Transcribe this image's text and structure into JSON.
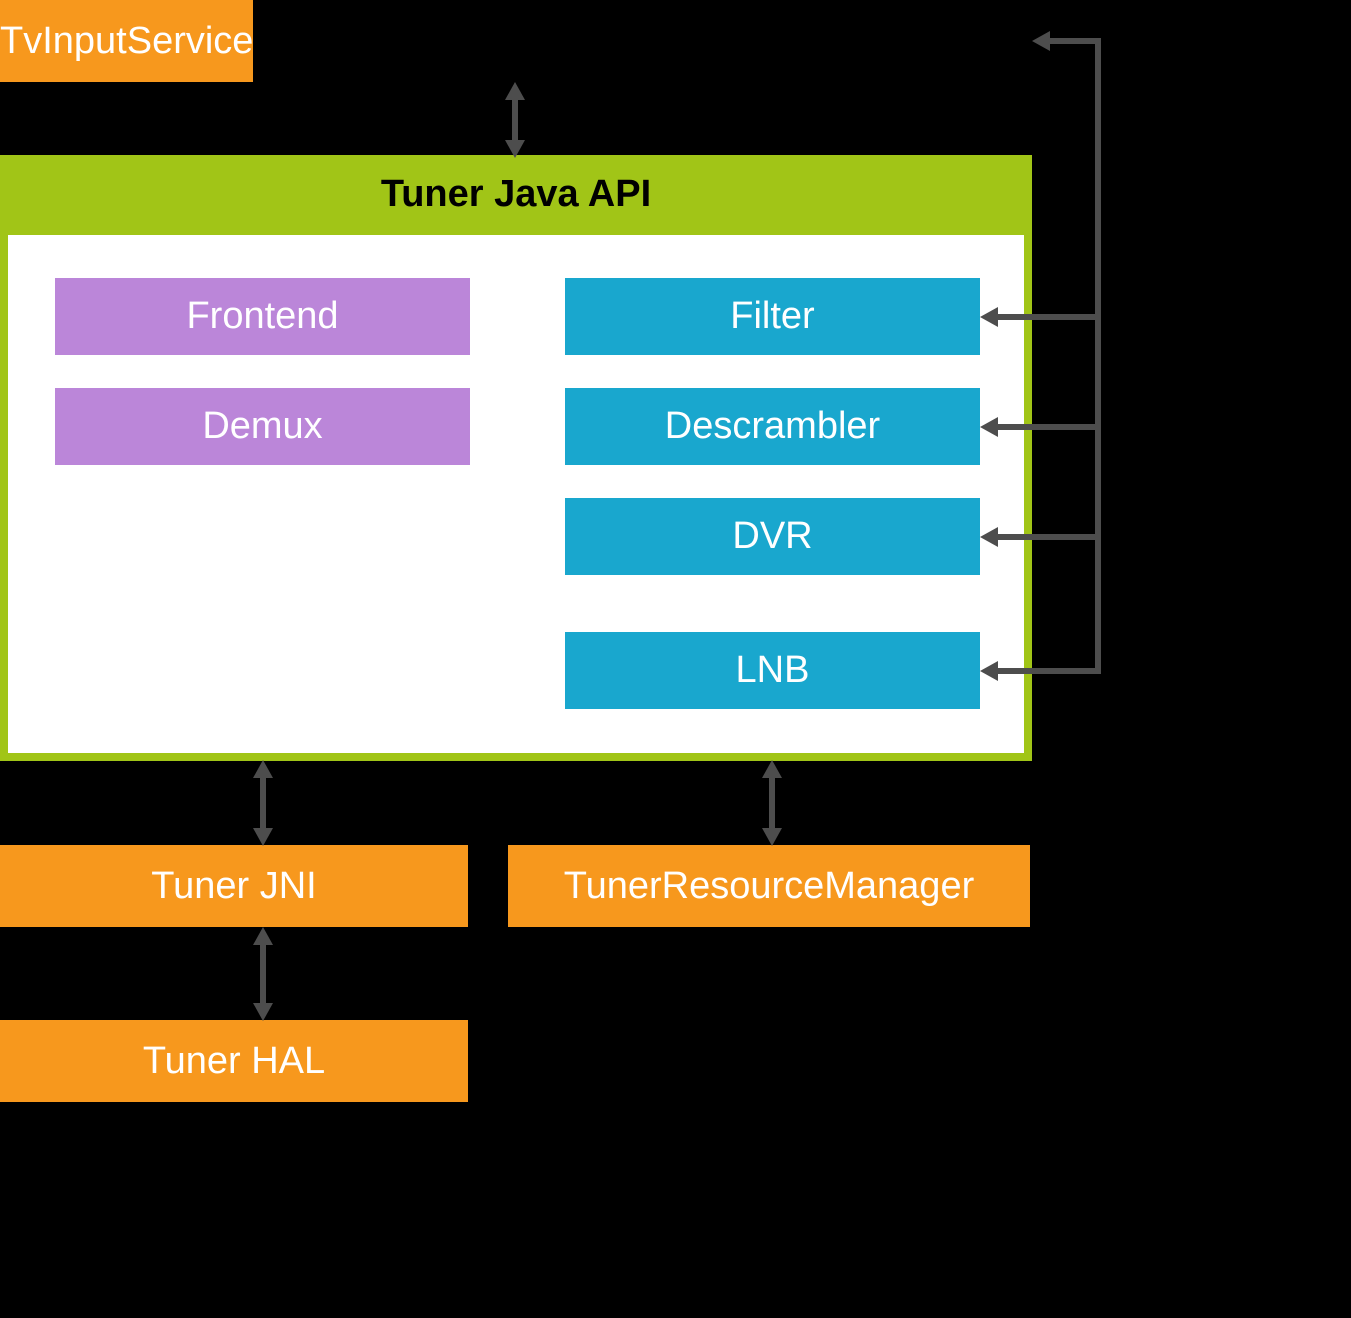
{
  "top": {
    "label": "TvInputService"
  },
  "middle": {
    "title": "Tuner Java API",
    "left": {
      "frontend": "Frontend",
      "demux": "Demux"
    },
    "right": {
      "filter": "Filter",
      "descrambler": "Descrambler",
      "dvr": "DVR",
      "lnb": "LNB"
    }
  },
  "bottom": {
    "jni": "Tuner JNI",
    "trm": "TunerResourceManager",
    "hal": "Tuner HAL"
  }
}
